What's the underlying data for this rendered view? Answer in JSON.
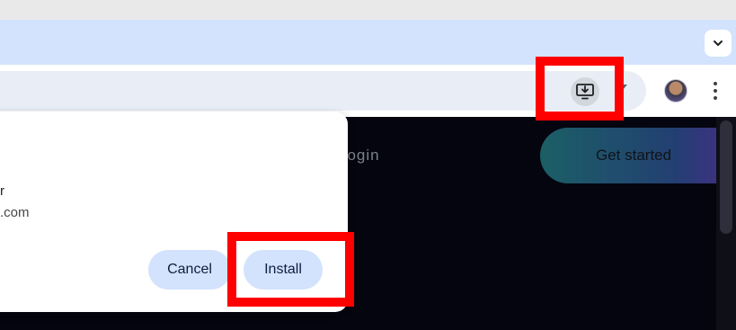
{
  "tab_strip": {
    "tab_search_icon": "chevron-down-icon"
  },
  "toolbar": {
    "install_app_icon": "monitor-download-icon",
    "menu_icon": "more-vert-icon"
  },
  "page": {
    "login_label": "Login",
    "get_started_label": "Get started"
  },
  "dialog": {
    "app_name_fragment": "r",
    "app_domain_fragment": ".com",
    "cancel_label": "Cancel",
    "install_label": "Install"
  },
  "annotations": {
    "highlight_color": "#ff0000"
  }
}
